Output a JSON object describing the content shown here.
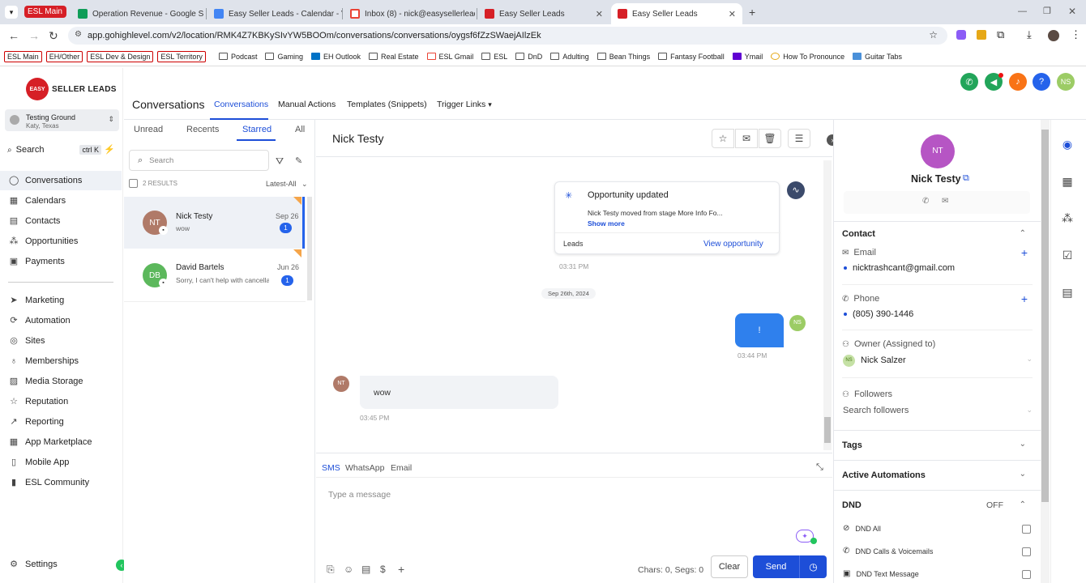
{
  "browser": {
    "tabs": [
      {
        "label": "ESL Main",
        "fav_color": "#d61f26"
      },
      {
        "label": "Operation Revenue - Google S",
        "fav_color": "#0f9d58"
      },
      {
        "label": "Easy Seller Leads - Calendar - V",
        "fav_color": "#4285f4"
      },
      {
        "label": "Inbox (8) - nick@easysellerlead",
        "fav_color": "#ea4335"
      },
      {
        "label": "Easy Seller Leads",
        "fav_color": "#d61f26"
      },
      {
        "label": "Easy Seller Leads",
        "fav_color": "#d61f26"
      }
    ],
    "url": "app.gohighlevel.com/v2/location/RMK4Z7KBKySIvYW5BOOm/conversations/conversations/oygsf6fZzSWaejAIlzEk",
    "bookmarks": [
      {
        "label": "ESL Main",
        "tag": true
      },
      {
        "label": "EH/Other",
        "tag": true
      },
      {
        "label": "ESL Dev & Design",
        "tag": true
      },
      {
        "label": "ESL Territory",
        "tag": true
      },
      {
        "label": "Podcast"
      },
      {
        "label": "Gaming"
      },
      {
        "label": "EH Outlook"
      },
      {
        "label": "Real Estate"
      },
      {
        "label": "ESL Gmail"
      },
      {
        "label": "ESL"
      },
      {
        "label": "DnD"
      },
      {
        "label": "Adulting"
      },
      {
        "label": "Bean Things"
      },
      {
        "label": "Fantasy Football"
      },
      {
        "label": "Ymail"
      },
      {
        "label": "How To Pronounce"
      },
      {
        "label": "Guitar Tabs"
      }
    ]
  },
  "sidebar": {
    "logo_badge": "EASY",
    "logo_text": "SELLER LEADS",
    "location_name": "Testing Ground",
    "location_sub": "Katy, Texas",
    "search_label": "Search",
    "search_shortcut": "ctrl K",
    "items": [
      {
        "label": "Conversations",
        "icon": "chat-icon"
      },
      {
        "label": "Calendars",
        "icon": "calendar-icon"
      },
      {
        "label": "Contacts",
        "icon": "contacts-icon"
      },
      {
        "label": "Opportunities",
        "icon": "opportunities-icon"
      },
      {
        "label": "Payments",
        "icon": "payments-icon"
      }
    ],
    "items2": [
      {
        "label": "Marketing",
        "icon": "send-icon"
      },
      {
        "label": "Automation",
        "icon": "automation-icon"
      },
      {
        "label": "Sites",
        "icon": "globe-icon"
      },
      {
        "label": "Memberships",
        "icon": "membership-icon"
      },
      {
        "label": "Media Storage",
        "icon": "media-icon"
      },
      {
        "label": "Reputation",
        "icon": "star-icon"
      },
      {
        "label": "Reporting",
        "icon": "chart-icon"
      },
      {
        "label": "App Marketplace",
        "icon": "grid-icon"
      },
      {
        "label": "Mobile App",
        "icon": "mobile-icon"
      },
      {
        "label": "ESL Community",
        "icon": "bookmark-icon"
      }
    ],
    "settings_label": "Settings"
  },
  "header": {
    "title": "Conversations",
    "tabs": [
      "Conversations",
      "Manual Actions",
      "Templates (Snippets)",
      "Trigger Links"
    ],
    "user_initials": "NS"
  },
  "convlist": {
    "tabs": [
      "Unread",
      "Recents",
      "Starred",
      "All"
    ],
    "search_placeholder": "Search",
    "results": "2 RESULTS",
    "sort": "Latest-All",
    "items": [
      {
        "initials": "NT",
        "name": "Nick Testy",
        "preview": "wow",
        "date": "Sep 26",
        "count": "1",
        "color": "#b07a68"
      },
      {
        "initials": "DB",
        "name": "David Bartels",
        "preview": "Sorry, I can't help with cancellat",
        "date": "Jun 26",
        "count": "1",
        "color": "#5cb85c"
      }
    ]
  },
  "chat": {
    "contact_name": "Nick Testy",
    "opportunity": {
      "title": "Opportunity updated",
      "body": "Nick Testy moved from stage More Info Fo...",
      "show_more": "Show more",
      "pipeline": "Leads",
      "link": "View opportunity",
      "time": "03:31 PM"
    },
    "date_divider": "Sep 26th, 2024",
    "outgoing": {
      "text": "!",
      "time": "03:44 PM",
      "initials": "NS"
    },
    "incoming": {
      "text": "wow",
      "time": "03:45 PM",
      "initials": "NT"
    },
    "composer": {
      "tabs": [
        "SMS",
        "WhatsApp",
        "Email"
      ],
      "placeholder": "Type a message",
      "counter": "Chars: 0, Segs: 0",
      "clear": "Clear",
      "send": "Send"
    }
  },
  "contact": {
    "initials": "NT",
    "name": "Nick Testy",
    "section_contact": "Contact",
    "email_label": "Email",
    "email": "nicktrashcant@gmail.com",
    "phone_label": "Phone",
    "phone": "(805) 390-1446",
    "owner_label": "Owner (Assigned to)",
    "owner_initials": "NS",
    "owner": "Nick Salzer",
    "followers_label": "Followers",
    "followers_placeholder": "Search followers",
    "tags": "Tags",
    "automations": "Active Automations",
    "dnd": "DND",
    "dnd_state": "OFF",
    "dnd_items": [
      "DND All",
      "DND Calls & Voicemails",
      "DND Text Message"
    ]
  },
  "colors": {
    "accent": "#1d4ed8",
    "brand": "#d61f26"
  }
}
